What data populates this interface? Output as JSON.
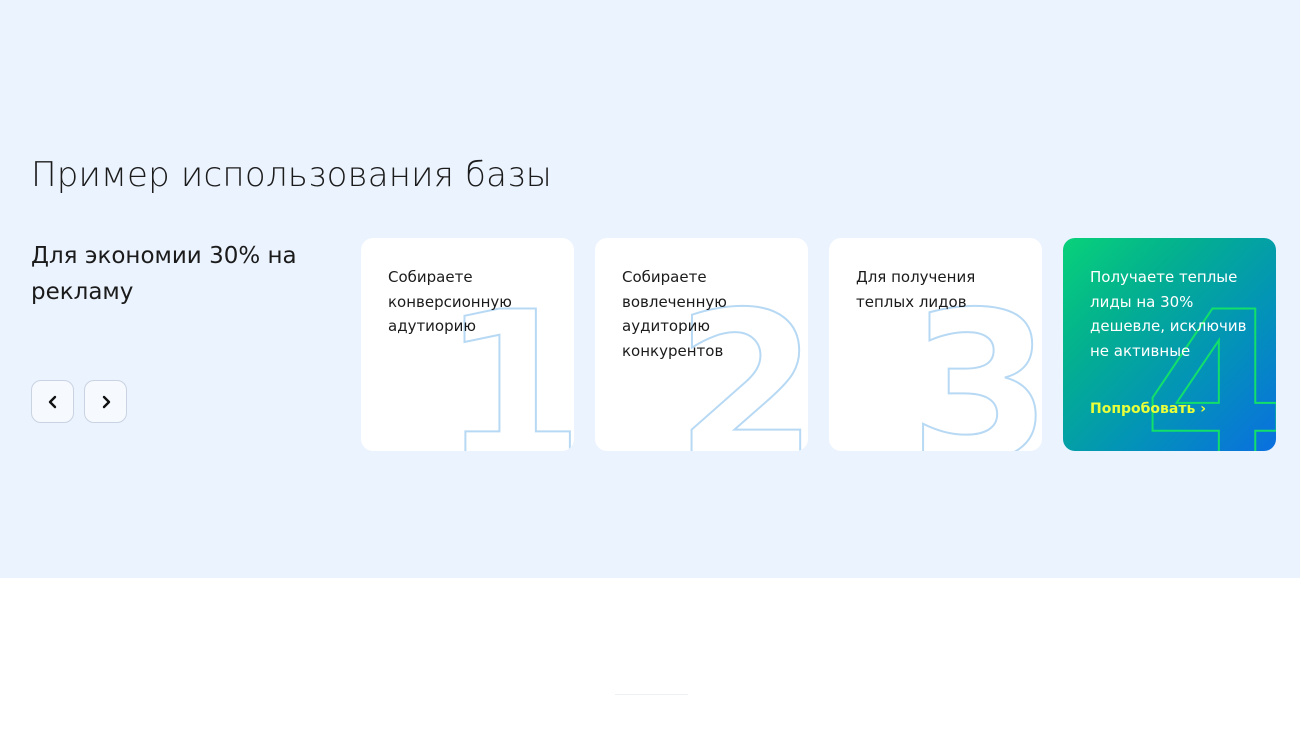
{
  "section": {
    "title": "Пример использования базы",
    "subtitle": "Для экономии 30% на рекламу"
  },
  "navigation": {
    "prev_icon": "chevron-left-icon",
    "next_icon": "chevron-right-icon"
  },
  "cards": [
    {
      "text": "Собираете конверсионную адутиорию",
      "number": "1"
    },
    {
      "text": "Собираете вовлеченную аудиторию конкурентов",
      "number": "2"
    },
    {
      "text": "Для получения теплых лидов",
      "number": "3"
    },
    {
      "text": "Получаете теплые лиды на 30% дешевле, исключив не активные",
      "number": "4",
      "link": "Попробовать ›"
    }
  ],
  "colors": {
    "section_background": "#ebf3fe",
    "accent_link": "#e8ff3a",
    "gradient_start": "#08d27a",
    "gradient_end": "#0a6fe0"
  }
}
